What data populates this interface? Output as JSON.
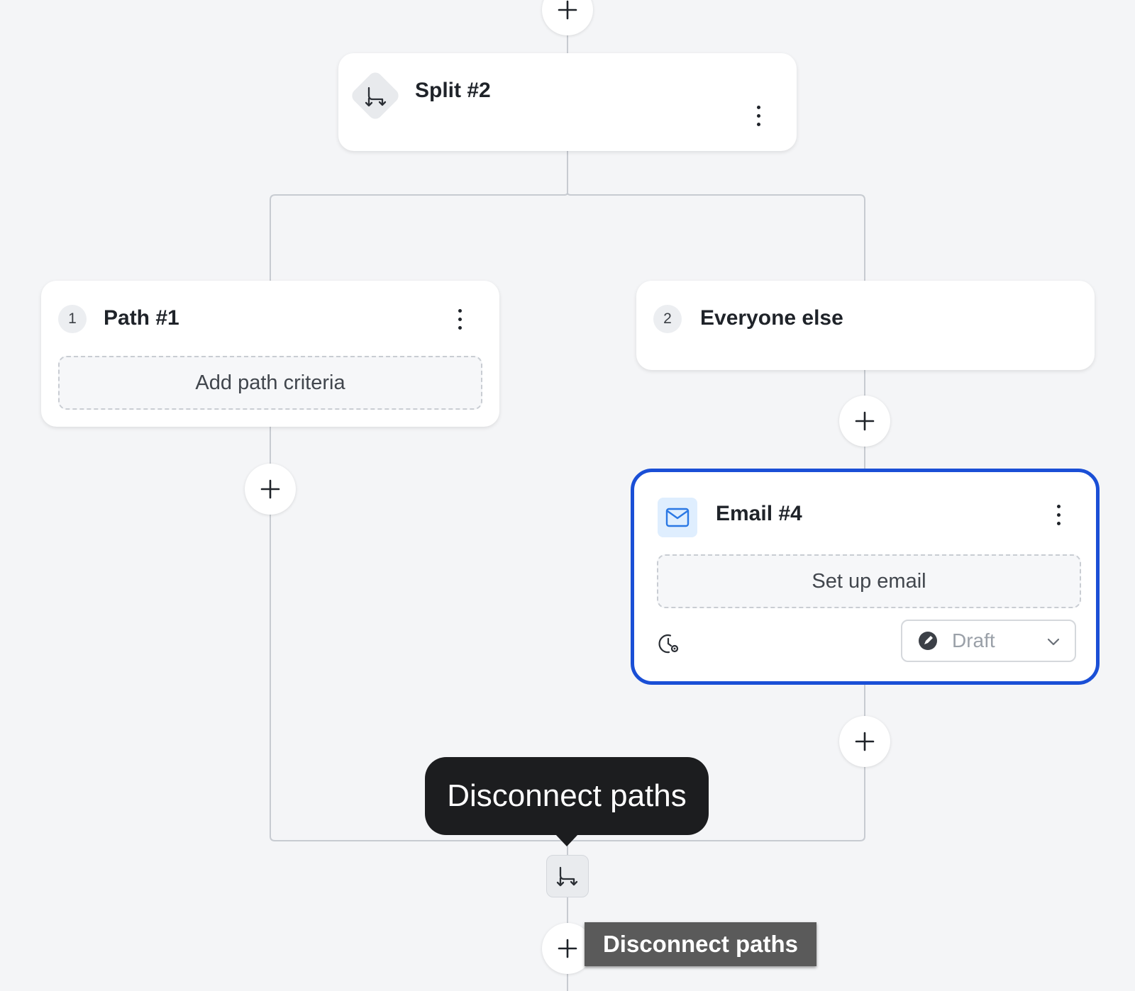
{
  "split_node": {
    "title": "Split #2",
    "icon": "split-icon",
    "menu_icon": "kebab-menu-icon"
  },
  "paths": [
    {
      "number": "1",
      "title": "Path #1",
      "action_label": "Add path criteria",
      "menu_icon": "kebab-menu-icon"
    },
    {
      "number": "2",
      "title": "Everyone else"
    }
  ],
  "email_node": {
    "title": "Email #4",
    "icon": "mail-icon",
    "action_label": "Set up email",
    "status": {
      "value": "Draft",
      "icon": "draft-icon"
    },
    "schedule_icon": "schedule-settings-icon",
    "selected": true,
    "accent_color": "#1a4fd6"
  },
  "tooltip": {
    "text": "Disconnect paths"
  },
  "native_tooltip": {
    "text": "Disconnect paths"
  },
  "colors": {
    "background": "#f4f5f7",
    "connector": "#c7cbd1",
    "selection": "#1a4fd6",
    "tooltip_bg": "#1c1d1f"
  }
}
